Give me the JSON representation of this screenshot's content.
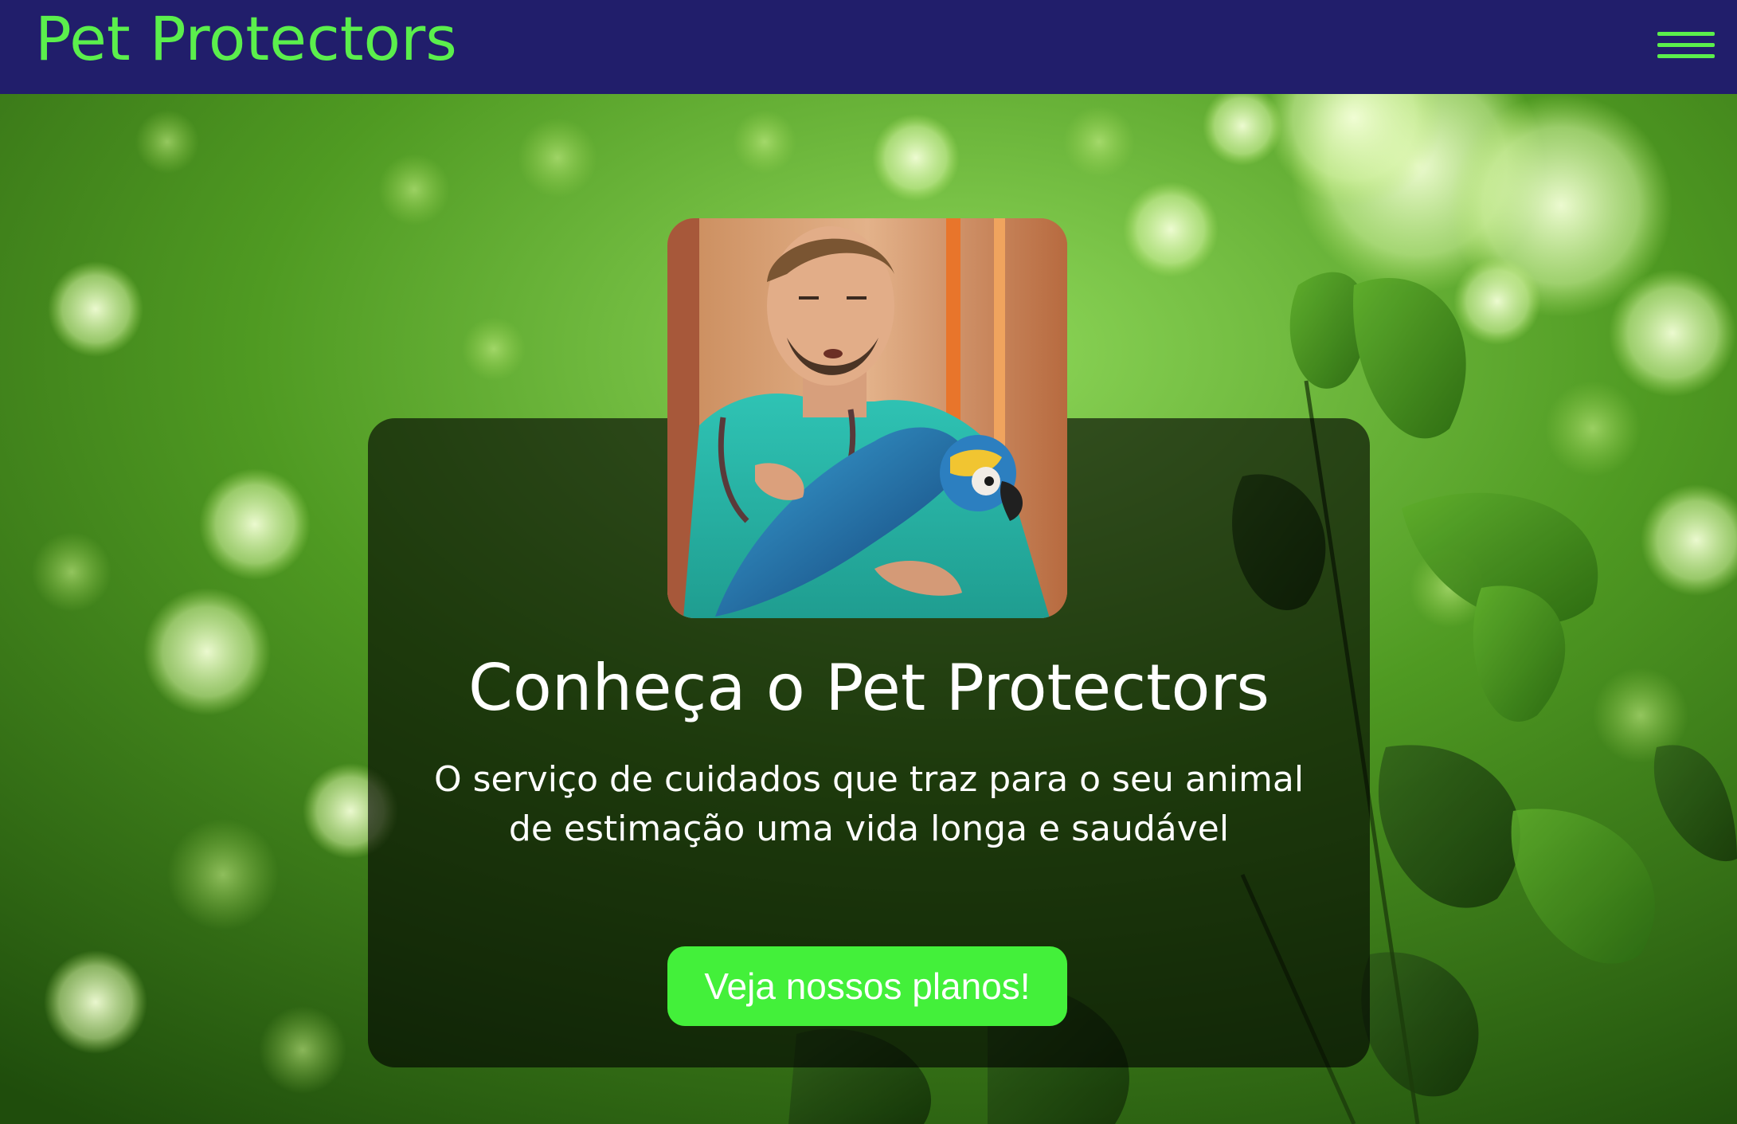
{
  "header": {
    "brand": "Pet Protectors",
    "menu_icon": "hamburger-menu-icon"
  },
  "hero": {
    "background_image": "green-leaves-bokeh",
    "photo": "veterinarian-with-macaw"
  },
  "card": {
    "title": "Conheça o Pet Protectors",
    "subtitle_line1": "O serviço de cuidados que traz para o seu animal",
    "subtitle_line2": "de estimação uma vida longa e saudável",
    "cta_label": "Veja nossos planos!"
  },
  "colors": {
    "header_bg": "#211e6b",
    "brand": "#5bef4c",
    "cta_bg": "#43f03a",
    "card_bg": "rgba(0,0,0,0.62)"
  }
}
